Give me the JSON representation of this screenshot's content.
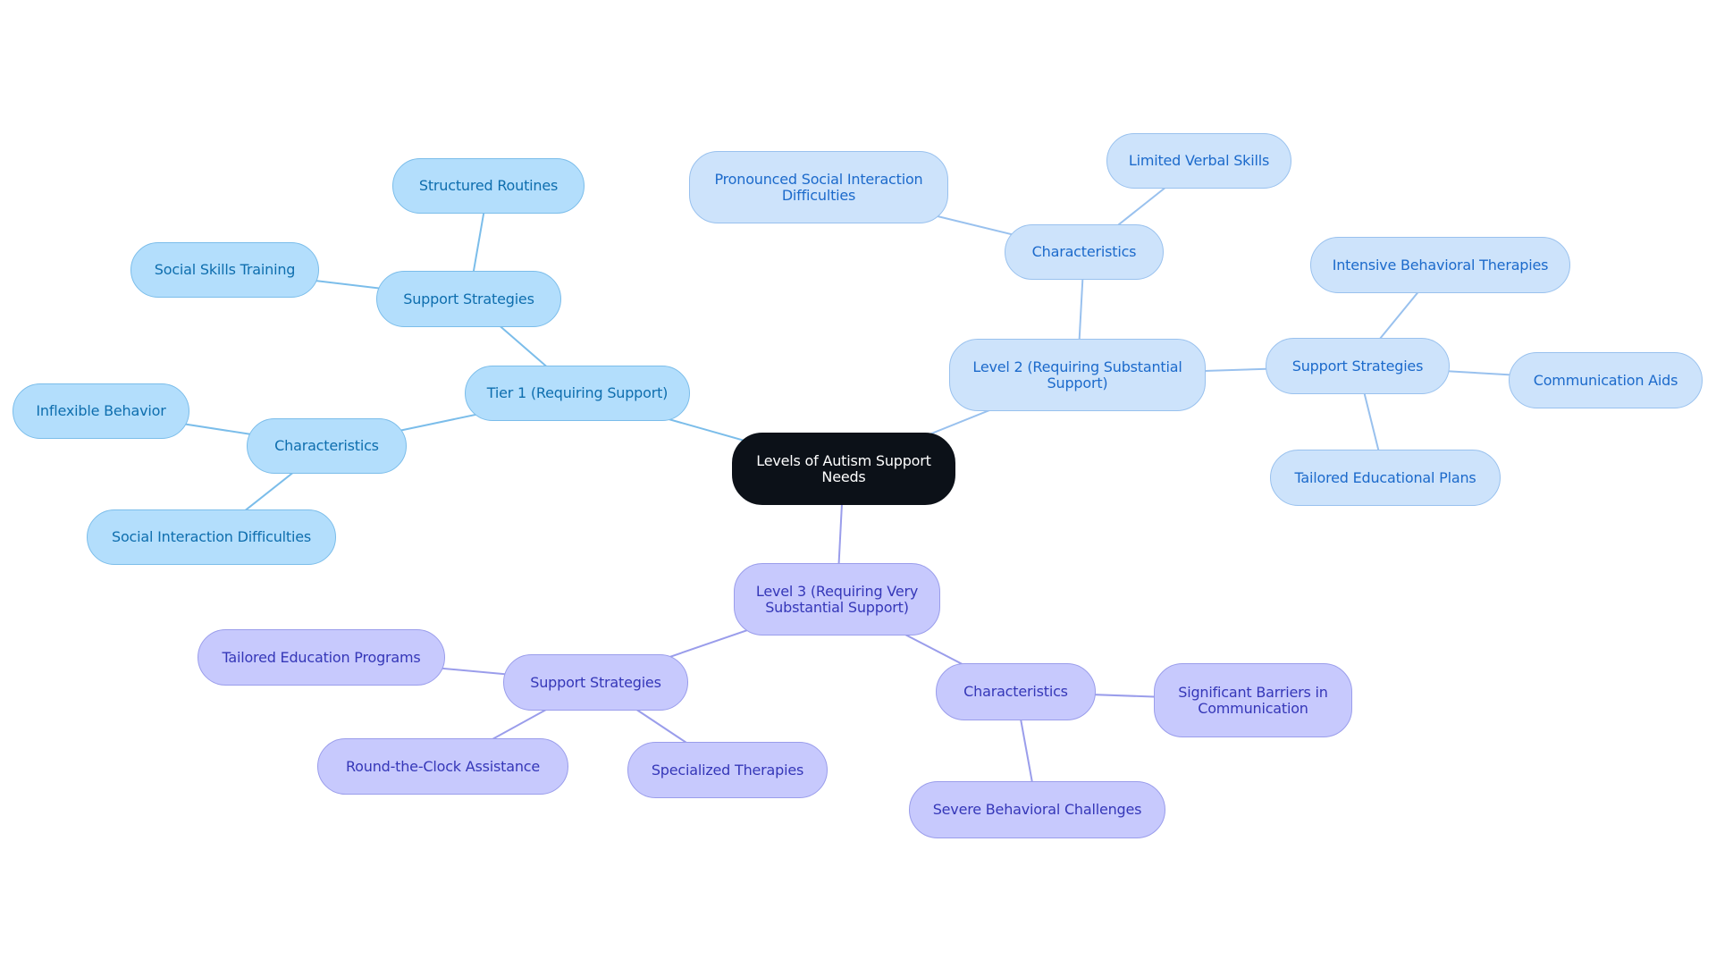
{
  "diagram": {
    "type": "mindmap",
    "colors": {
      "root_fill": "#0c1118",
      "tier1_fill": "#b3defc",
      "tier1_line": "#7bbdea",
      "level2_fill": "#cde3fb",
      "level2_line": "#99c1ee",
      "level3_fill": "#c7c9fd",
      "level3_line": "#9a9deb"
    },
    "root": {
      "id": "root",
      "label": "Levels of Autism Support Needs"
    },
    "nodes": [
      {
        "id": "t1",
        "parent": "root",
        "group": "t1",
        "label": "Tier 1 (Requiring Support)"
      },
      {
        "id": "t1-ss",
        "parent": "t1",
        "group": "t1",
        "label": "Support Strategies"
      },
      {
        "id": "t1-ss-sr",
        "parent": "t1-ss",
        "group": "t1",
        "label": "Structured Routines"
      },
      {
        "id": "t1-ss-sst",
        "parent": "t1-ss",
        "group": "t1",
        "label": "Social Skills Training"
      },
      {
        "id": "t1-ch",
        "parent": "t1",
        "group": "t1",
        "label": "Characteristics"
      },
      {
        "id": "t1-ch-ib",
        "parent": "t1-ch",
        "group": "t1",
        "label": "Inflexible Behavior"
      },
      {
        "id": "t1-ch-sid",
        "parent": "t1-ch",
        "group": "t1",
        "label": "Social Interaction Difficulties"
      },
      {
        "id": "l2",
        "parent": "root",
        "group": "t2",
        "label": "Level 2 (Requiring Substantial Support)"
      },
      {
        "id": "l2-ch",
        "parent": "l2",
        "group": "t2",
        "label": "Characteristics"
      },
      {
        "id": "l2-ch-psid",
        "parent": "l2-ch",
        "group": "t2",
        "label": "Pronounced Social Interaction Difficulties"
      },
      {
        "id": "l2-ch-lvs",
        "parent": "l2-ch",
        "group": "t2",
        "label": "Limited Verbal Skills"
      },
      {
        "id": "l2-ss",
        "parent": "l2",
        "group": "t2",
        "label": "Support Strategies"
      },
      {
        "id": "l2-ss-ibt",
        "parent": "l2-ss",
        "group": "t2",
        "label": "Intensive Behavioral Therapies"
      },
      {
        "id": "l2-ss-ca",
        "parent": "l2-ss",
        "group": "t2",
        "label": "Communication Aids"
      },
      {
        "id": "l2-ss-tep",
        "parent": "l2-ss",
        "group": "t2",
        "label": "Tailored Educational Plans"
      },
      {
        "id": "l3",
        "parent": "root",
        "group": "t3",
        "label": "Level 3 (Requiring Very Substantial Support)"
      },
      {
        "id": "l3-ss",
        "parent": "l3",
        "group": "t3",
        "label": "Support Strategies"
      },
      {
        "id": "l3-ss-tedp",
        "parent": "l3-ss",
        "group": "t3",
        "label": "Tailored Education Programs"
      },
      {
        "id": "l3-ss-rca",
        "parent": "l3-ss",
        "group": "t3",
        "label": "Round-the-Clock Assistance"
      },
      {
        "id": "l3-ss-st",
        "parent": "l3-ss",
        "group": "t3",
        "label": "Specialized Therapies"
      },
      {
        "id": "l3-ch",
        "parent": "l3",
        "group": "t3",
        "label": "Characteristics"
      },
      {
        "id": "l3-ch-sbc",
        "parent": "l3-ch",
        "group": "t3",
        "label": "Significant Barriers in Communication"
      },
      {
        "id": "l3-ch-sevbc",
        "parent": "l3-ch",
        "group": "t3",
        "label": "Severe Behavioral Challenges"
      }
    ]
  }
}
